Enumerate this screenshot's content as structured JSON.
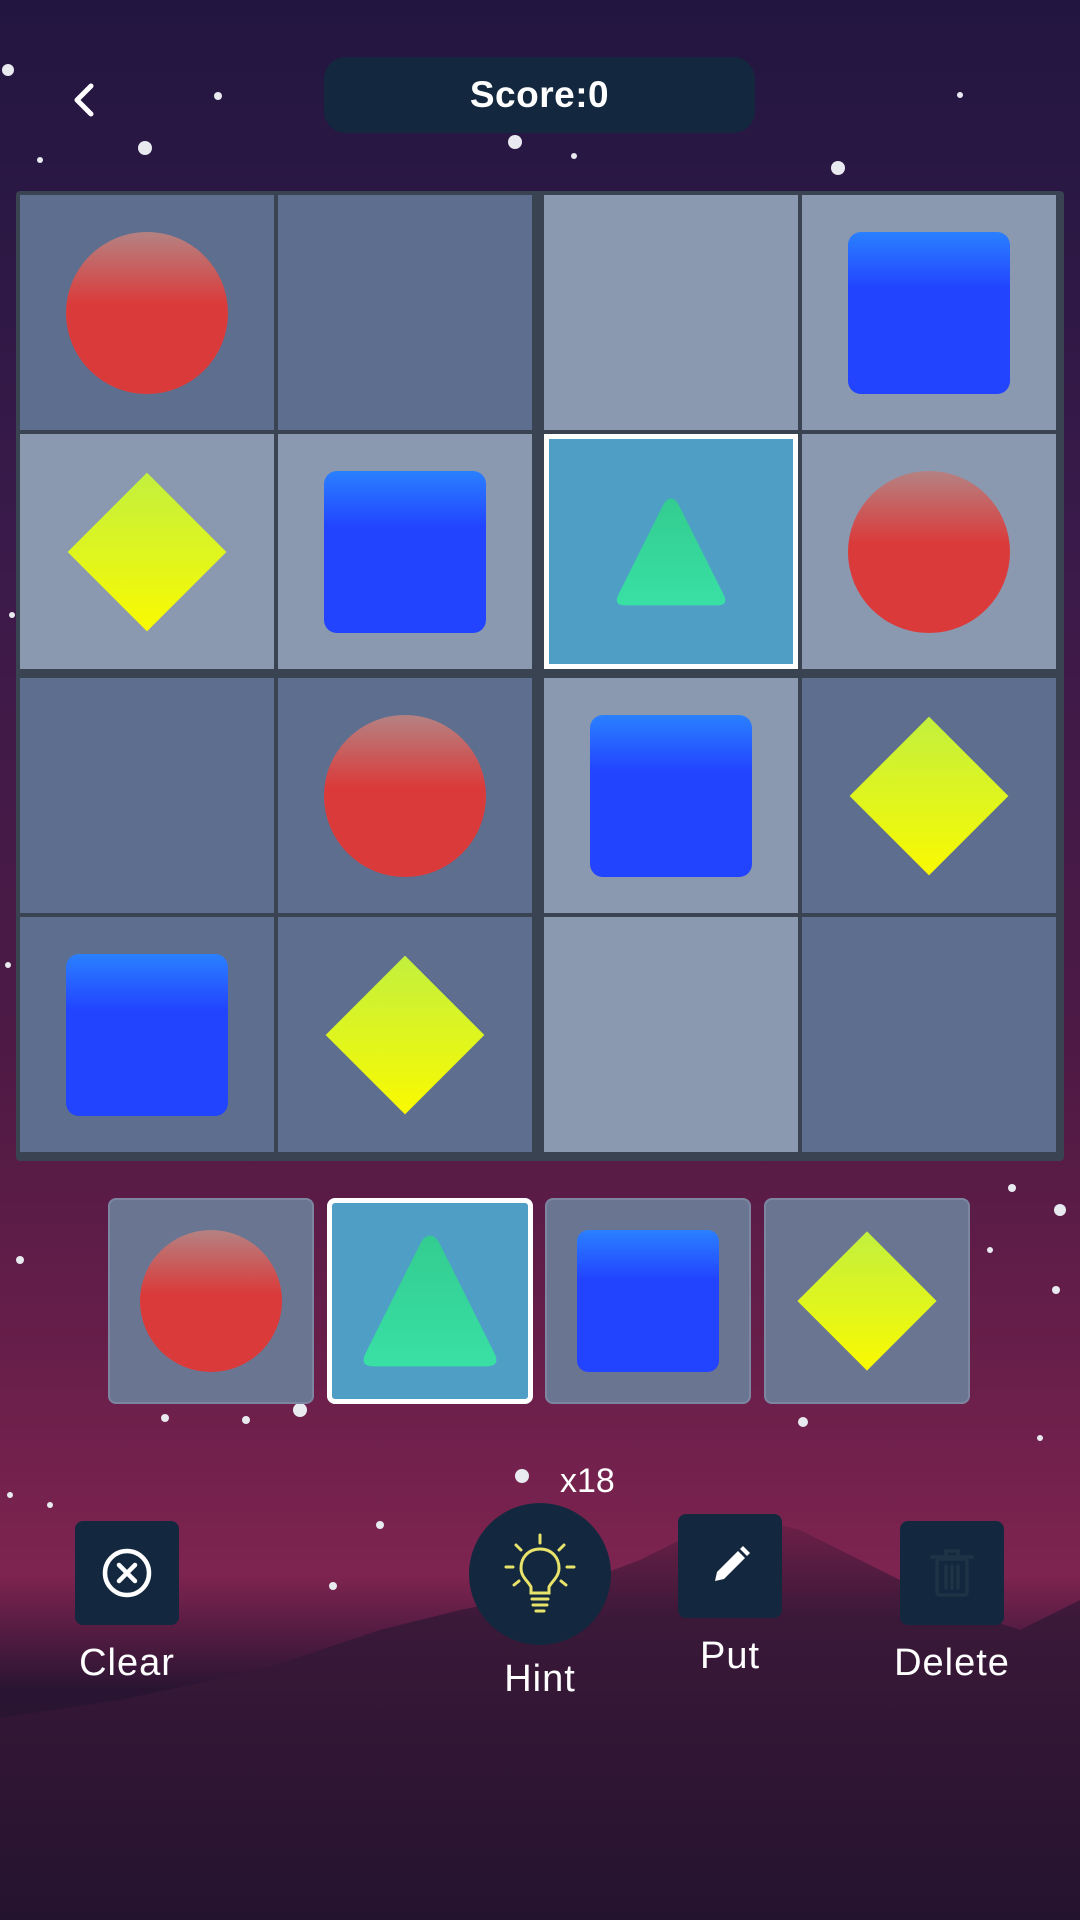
{
  "header": {
    "back_label": "back",
    "score_label": "Score:",
    "score_value": "0"
  },
  "colors": {
    "circle": "#db3a3a",
    "square": "#2244ff",
    "diamond": "#f4fa10",
    "triangle": "#39e0a4",
    "cell_dark": "#5e6e8e",
    "cell_light": "#8a98b0",
    "cell_selected": "#4f9ec6",
    "button_bg": "#13283e"
  },
  "board": {
    "rows": [
      [
        {
          "shape": "circle",
          "tone": "dark"
        },
        {
          "shape": "empty",
          "tone": "dark"
        },
        {
          "shape": "empty",
          "tone": "light"
        },
        {
          "shape": "square",
          "tone": "light"
        }
      ],
      [
        {
          "shape": "diamond",
          "tone": "light"
        },
        {
          "shape": "square",
          "tone": "light"
        },
        {
          "shape": "triangle",
          "tone": "selected"
        },
        {
          "shape": "circle",
          "tone": "light"
        }
      ],
      [
        {
          "shape": "empty",
          "tone": "dark"
        },
        {
          "shape": "circle",
          "tone": "dark"
        },
        {
          "shape": "square",
          "tone": "light"
        },
        {
          "shape": "diamond",
          "tone": "dark"
        }
      ],
      [
        {
          "shape": "square",
          "tone": "dark"
        },
        {
          "shape": "diamond",
          "tone": "dark"
        },
        {
          "shape": "empty",
          "tone": "light"
        },
        {
          "shape": "empty",
          "tone": "dark"
        }
      ]
    ]
  },
  "palette": [
    {
      "shape": "circle",
      "selected": false
    },
    {
      "shape": "triangle",
      "selected": true
    },
    {
      "shape": "square",
      "selected": false
    },
    {
      "shape": "diamond",
      "selected": false
    }
  ],
  "toolbar": {
    "clear_label": "Clear",
    "clear_icon": "close-circle-icon",
    "hint_label": "Hint",
    "hint_icon": "lightbulb-icon",
    "hint_count": "x18",
    "put_label": "Put",
    "put_icon": "pencil-icon",
    "delete_label": "Delete",
    "delete_icon": "trash-icon"
  }
}
